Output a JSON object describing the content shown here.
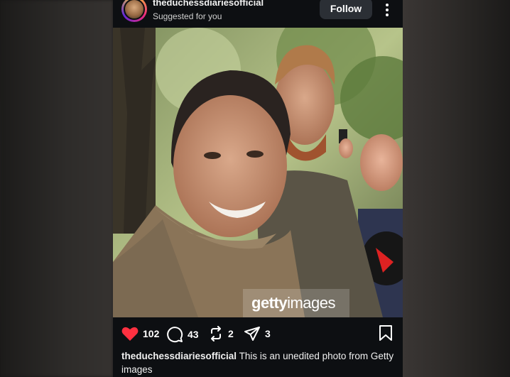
{
  "post": {
    "username": "theduchessdiariesofficial",
    "subtitle": "Suggested for you",
    "follow_label": "Follow",
    "watermark_brand": "getty",
    "watermark_suffix": "images",
    "actions": {
      "likes": "102",
      "comments": "43",
      "reposts": "2",
      "shares": "3"
    },
    "caption_user": "theduchessdiariesofficial",
    "caption_text": " This is an unedited photo from Getty images"
  },
  "colors": {
    "heart": "#ff3040",
    "follow_bg": "#2b2f35",
    "post_bg": "#0d0f12"
  },
  "icons": [
    "heart-icon",
    "comment-icon",
    "repost-icon",
    "share-icon",
    "bookmark-icon",
    "more-icon"
  ]
}
